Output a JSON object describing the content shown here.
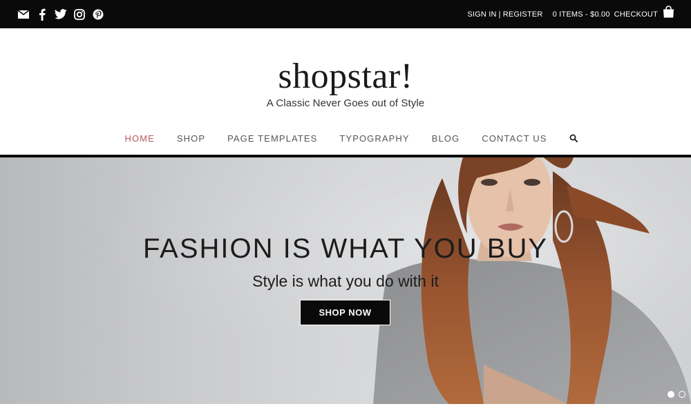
{
  "topbar": {
    "social_icons": [
      "email-icon",
      "facebook-icon",
      "twitter-icon",
      "instagram-icon",
      "pinterest-icon"
    ],
    "sign_in": "SIGN IN",
    "separator": "|",
    "register": "REGISTER",
    "cart_summary": "0 ITEMS - $0.00",
    "checkout": "CHECKOUT",
    "cart_icon": "shopping-bag-icon"
  },
  "brand": {
    "logo": "shopstar!",
    "tagline": "A Classic Never Goes out of Style"
  },
  "nav": {
    "items": [
      {
        "label": "HOME",
        "active": true
      },
      {
        "label": "SHOP",
        "active": false
      },
      {
        "label": "PAGE TEMPLATES",
        "active": false
      },
      {
        "label": "TYPOGRAPHY",
        "active": false
      },
      {
        "label": "BLOG",
        "active": false
      },
      {
        "label": "CONTACT US",
        "active": false
      }
    ],
    "search_icon": "search-icon"
  },
  "hero": {
    "title": "FASHION IS WHAT YOU BUY",
    "subtitle": "Style is what you do with it",
    "button": "SHOP NOW",
    "slides": 2,
    "active_slide": 1
  },
  "colors": {
    "topbar_bg": "#0a0a0a",
    "nav_active": "#b5585c",
    "button_bg": "#0a0a0a"
  }
}
